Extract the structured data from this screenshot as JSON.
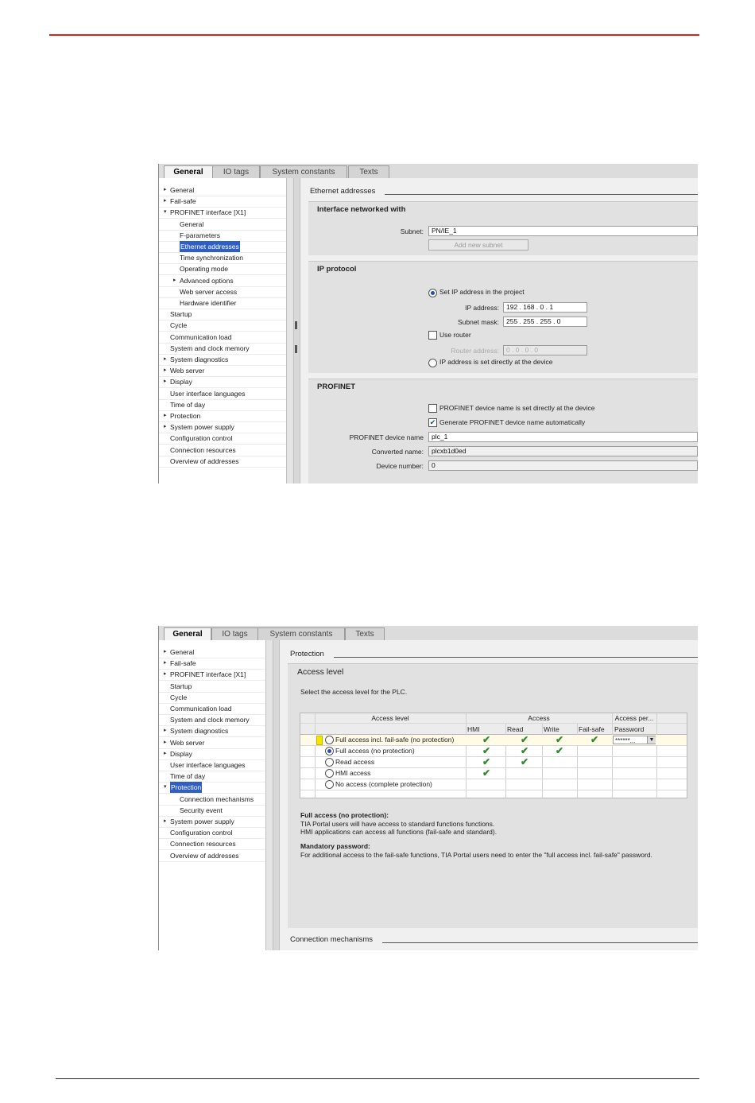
{
  "shot1": {
    "tabs": [
      "General",
      "IO tags",
      "System constants",
      "Texts"
    ],
    "tree": [
      {
        "label": "General",
        "arrow": "▸",
        "indent": 0
      },
      {
        "label": "Fail-safe",
        "arrow": "▸",
        "indent": 0,
        "warn": true
      },
      {
        "label": "PROFINET interface [X1]",
        "arrow": "▾",
        "indent": 0
      },
      {
        "label": "General",
        "arrow": "",
        "indent": 1
      },
      {
        "label": "F-parameters",
        "arrow": "",
        "indent": 1,
        "warn": true
      },
      {
        "label": "Ethernet addresses",
        "arrow": "",
        "indent": 1,
        "selected": true
      },
      {
        "label": "Time synchronization",
        "arrow": "",
        "indent": 1
      },
      {
        "label": "Operating mode",
        "arrow": "",
        "indent": 1
      },
      {
        "label": "Advanced options",
        "arrow": "▸",
        "indent": 1
      },
      {
        "label": "Web server access",
        "arrow": "",
        "indent": 1
      },
      {
        "label": "Hardware identifier",
        "arrow": "",
        "indent": 1
      },
      {
        "label": "Startup",
        "arrow": "",
        "indent": 0
      },
      {
        "label": "Cycle",
        "arrow": "",
        "indent": 0
      },
      {
        "label": "Communication load",
        "arrow": "",
        "indent": 0
      },
      {
        "label": "System and clock memory",
        "arrow": "",
        "indent": 0
      },
      {
        "label": "System diagnostics",
        "arrow": "▸",
        "indent": 0
      },
      {
        "label": "Web server",
        "arrow": "▸",
        "indent": 0
      },
      {
        "label": "Display",
        "arrow": "▸",
        "indent": 0
      },
      {
        "label": "User interface languages",
        "arrow": "",
        "indent": 0
      },
      {
        "label": "Time of day",
        "arrow": "",
        "indent": 0
      },
      {
        "label": "Protection",
        "arrow": "▸",
        "indent": 0,
        "warn": true
      },
      {
        "label": "System power supply",
        "arrow": "▸",
        "indent": 0
      },
      {
        "label": "Configuration control",
        "arrow": "",
        "indent": 0
      },
      {
        "label": "Connection resources",
        "arrow": "",
        "indent": 0
      },
      {
        "label": "Overview of addresses",
        "arrow": "",
        "indent": 0
      }
    ],
    "section_title": "Ethernet addresses",
    "interface": {
      "title": "Interface networked with",
      "subnet_label": "Subnet:",
      "subnet_value": "PN/IE_1",
      "add_subnet": "Add new subnet"
    },
    "ip": {
      "title": "IP protocol",
      "set_ip": "Set IP address in the project",
      "ip_label": "IP address:",
      "ip_value": "192 . 168 . 0    . 1",
      "mask_label": "Subnet mask:",
      "mask_value": "255 . 255 . 255 . 0",
      "use_router": "Use router",
      "router_label": "Router address:",
      "router_value": "0    . 0    . 0    . 0",
      "direct": "IP address is set directly at the device"
    },
    "profinet": {
      "title": "PROFINET",
      "name_direct": "PROFINET device name is set directly at the device",
      "generate": "Generate PROFINET device name automatically",
      "name_label": "PROFINET device name",
      "name_value": "plc_1",
      "converted_label": "Converted name:",
      "converted_value": "plcxb1d0ed",
      "number_label": "Device number:",
      "number_value": "0"
    }
  },
  "shot2": {
    "tabs": [
      "General",
      "IO tags",
      "System constants",
      "Texts"
    ],
    "tree": [
      {
        "label": "General",
        "arrow": "▸",
        "indent": 0
      },
      {
        "label": "Fail-safe",
        "arrow": "▸",
        "indent": 0,
        "warn": true
      },
      {
        "label": "PROFINET interface [X1]",
        "arrow": "▸",
        "indent": 0
      },
      {
        "label": "Startup",
        "arrow": "",
        "indent": 0
      },
      {
        "label": "Cycle",
        "arrow": "",
        "indent": 0
      },
      {
        "label": "Communication load",
        "arrow": "",
        "indent": 0
      },
      {
        "label": "System and clock memory",
        "arrow": "",
        "indent": 0
      },
      {
        "label": "System diagnostics",
        "arrow": "▸",
        "indent": 0
      },
      {
        "label": "Web server",
        "arrow": "▸",
        "indent": 0
      },
      {
        "label": "Display",
        "arrow": "▸",
        "indent": 0
      },
      {
        "label": "User interface languages",
        "arrow": "",
        "indent": 0
      },
      {
        "label": "Time of day",
        "arrow": "",
        "indent": 0
      },
      {
        "label": "Protection",
        "arrow": "▾",
        "indent": 0,
        "warn": true,
        "selected": true
      },
      {
        "label": "Connection mechanisms",
        "arrow": "",
        "indent": 1
      },
      {
        "label": "Security event",
        "arrow": "",
        "indent": 1
      },
      {
        "label": "System power supply",
        "arrow": "▸",
        "indent": 0
      },
      {
        "label": "Configuration control",
        "arrow": "",
        "indent": 0
      },
      {
        "label": "Connection resources",
        "arrow": "",
        "indent": 0
      },
      {
        "label": "Overview of addresses",
        "arrow": "",
        "indent": 0
      }
    ],
    "section_title": "Protection",
    "access": {
      "title": "Access level",
      "desc": "Select the access level for the PLC.",
      "col_access_level": "Access level",
      "col_access": "Access",
      "col_access_per": "Access per...",
      "sub_hmi": "HMI",
      "sub_read": "Read",
      "sub_write": "Write",
      "sub_failsafe": "Fail-safe",
      "sub_password": "Password",
      "password_value": "******...",
      "rows": [
        {
          "label": "Full access incl. fail-safe (no protection)",
          "selected": false,
          "hmi": true,
          "read": true,
          "write": true,
          "failsafe": true
        },
        {
          "label": "Full access (no protection)",
          "selected": true,
          "hmi": true,
          "read": true,
          "write": true,
          "failsafe": false
        },
        {
          "label": "Read access",
          "selected": false,
          "hmi": true,
          "read": true,
          "write": false,
          "failsafe": false
        },
        {
          "label": "HMI access",
          "selected": false,
          "hmi": true,
          "read": false,
          "write": false,
          "failsafe": false
        },
        {
          "label": "No access (complete protection)",
          "selected": false,
          "hmi": false,
          "read": false,
          "write": false,
          "failsafe": false
        }
      ],
      "tick": "✔"
    },
    "notes": {
      "h1": "Full access (no protection):",
      "l1": "TIA Portal users will have access to standard functions functions.",
      "l2": "HMI applications can access all functions (fail-safe and standard).",
      "h2": "Mandatory password:",
      "l3": "For additional access to the fail-safe functions, TIA Portal users need to enter the \"full access incl. fail-safe\" password."
    },
    "next_section": "Connection mechanisms"
  }
}
